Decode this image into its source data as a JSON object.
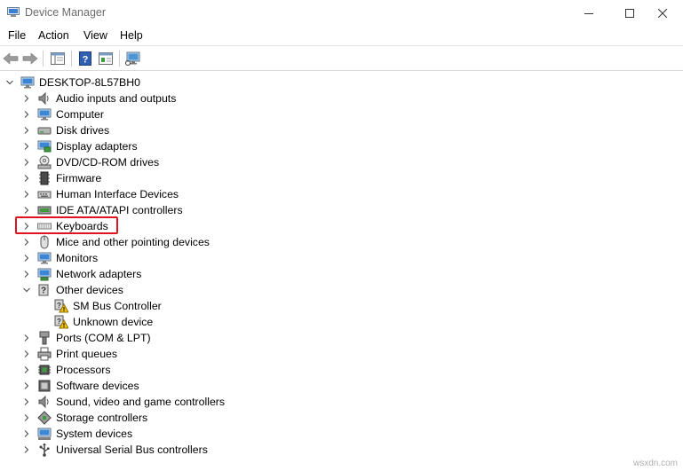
{
  "window": {
    "title": "Device Manager"
  },
  "menu": [
    "File",
    "Action",
    "View",
    "Help"
  ],
  "tree": {
    "root": "DESKTOP-8L57BH0",
    "categories": [
      {
        "label": "Audio inputs and outputs",
        "icon": "speaker-icon"
      },
      {
        "label": "Computer",
        "icon": "computer-icon"
      },
      {
        "label": "Disk drives",
        "icon": "disk-drive-icon"
      },
      {
        "label": "Display adapters",
        "icon": "display-adapter-icon"
      },
      {
        "label": "DVD/CD-ROM drives",
        "icon": "dvd-drive-icon"
      },
      {
        "label": "Firmware",
        "icon": "firmware-chip-icon"
      },
      {
        "label": "Human Interface Devices",
        "icon": "hid-icon"
      },
      {
        "label": "IDE ATA/ATAPI controllers",
        "icon": "ide-controller-icon"
      },
      {
        "label": "Keyboards",
        "icon": "keyboard-icon"
      },
      {
        "label": "Mice and other pointing devices",
        "icon": "mouse-icon"
      },
      {
        "label": "Monitors",
        "icon": "monitor-icon"
      },
      {
        "label": "Network adapters",
        "icon": "network-adapter-icon"
      },
      {
        "label": "Other devices",
        "icon": "unknown-device-icon"
      },
      {
        "label": "SM Bus Controller",
        "icon": "warning-device-icon"
      },
      {
        "label": "Unknown device",
        "icon": "warning-device-icon"
      },
      {
        "label": "Ports (COM & LPT)",
        "icon": "port-icon"
      },
      {
        "label": "Print queues",
        "icon": "printer-icon"
      },
      {
        "label": "Processors",
        "icon": "processor-icon"
      },
      {
        "label": "Software devices",
        "icon": "software-device-icon"
      },
      {
        "label": "Sound, video and game controllers",
        "icon": "sound-icon"
      },
      {
        "label": "Storage controllers",
        "icon": "storage-controller-icon"
      },
      {
        "label": "System devices",
        "icon": "system-device-icon"
      },
      {
        "label": "Universal Serial Bus controllers",
        "icon": "usb-icon"
      }
    ]
  },
  "colors": {
    "highlight": "#e0141e",
    "title_text": "#6b6b6b"
  },
  "watermark": "wsxdn.com"
}
